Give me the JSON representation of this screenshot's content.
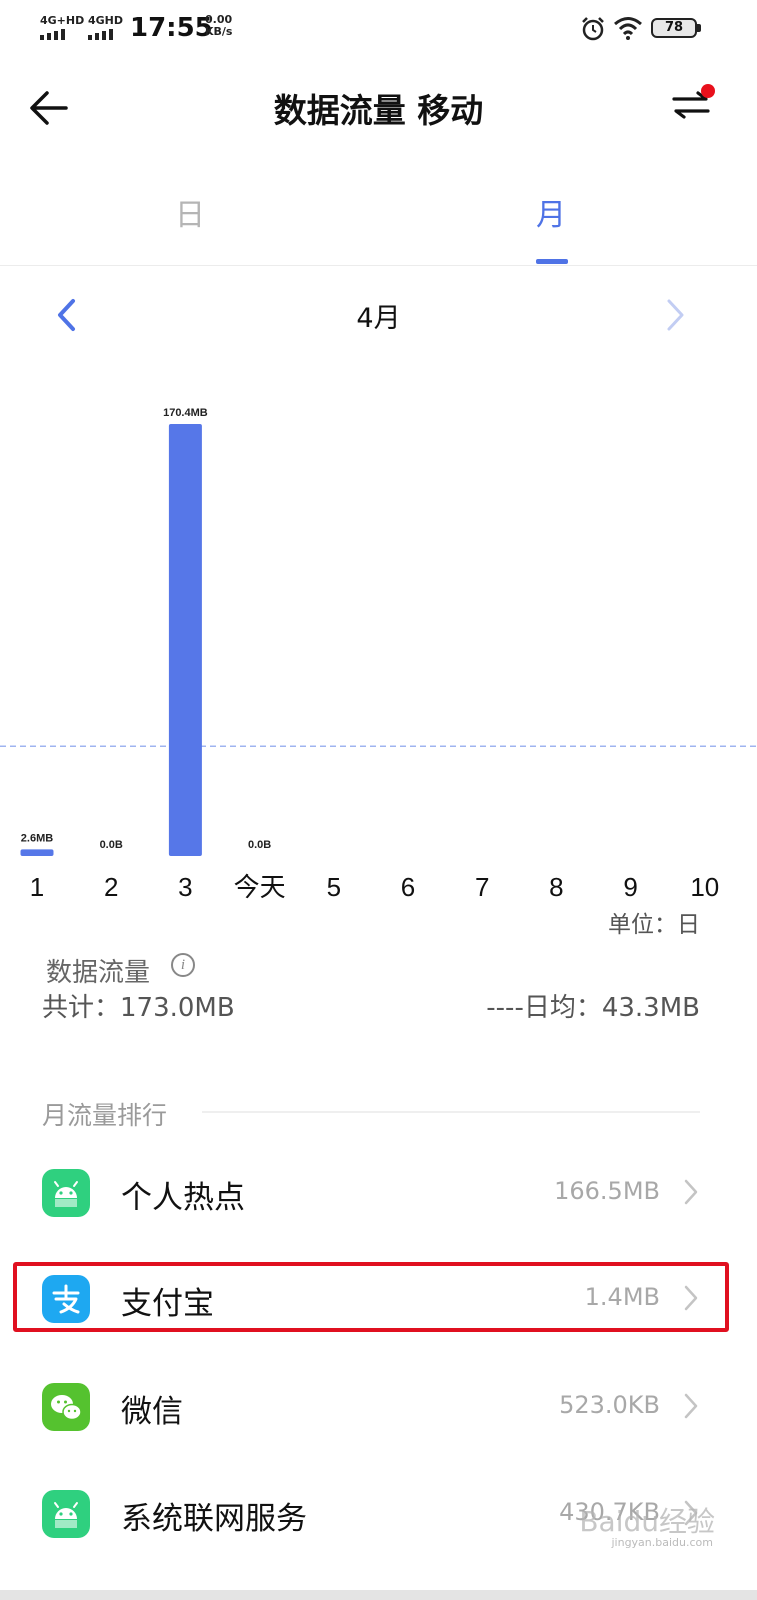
{
  "status_bar": {
    "sim1": "4G+HD",
    "sim2": "4GHD",
    "time": "17:55",
    "speed_value": "0.00",
    "speed_unit": "KB/s",
    "battery": "78"
  },
  "header": {
    "title": "数据流量 移动",
    "back_icon": "back-arrow-icon",
    "switch_icon": "swap-arrows-icon",
    "accent": "#4f73e6",
    "notify_dot_color": "#e8101c"
  },
  "tabs": [
    {
      "label": "日",
      "selected": false
    },
    {
      "label": "月",
      "selected": true
    }
  ],
  "month_nav": {
    "label": "4月",
    "prev_icon": "chevron-left-icon",
    "next_icon": "chevron-right-icon"
  },
  "chart_data": {
    "type": "bar",
    "categories": [
      "1",
      "2",
      "3",
      "今天",
      "5",
      "6",
      "7",
      "8",
      "9",
      "10"
    ],
    "values": [
      2.6,
      0.0,
      170.4,
      0.0,
      null,
      null,
      null,
      null,
      null,
      null
    ],
    "data_labels": [
      "2.6MB",
      "0.0B",
      "170.4MB",
      "0.0B"
    ],
    "ylim": [
      0,
      170.4
    ],
    "reference_line": 43.3,
    "bar_color": "#5677e8",
    "reference_line_color": "#9fb4f0"
  },
  "unit_label": "单位：日",
  "summary": {
    "title": "数据流量",
    "info_icon": "info-icon",
    "total": "共计：173.0MB",
    "daily_avg": "----日均：43.3MB"
  },
  "ranking": {
    "title": "月流量排行",
    "items": [
      {
        "name": "个人热点",
        "usage": "166.5MB",
        "icon": "android-icon"
      },
      {
        "name": "支付宝",
        "usage": "1.4MB",
        "icon": "alipay-icon"
      },
      {
        "name": "微信",
        "usage": "523.0KB",
        "icon": "wechat-icon"
      },
      {
        "name": "系统联网服务",
        "usage": "430.7KB",
        "icon": "android-icon"
      }
    ]
  },
  "highlight_color": "#e01020",
  "watermark": {
    "text": "Baidu经验",
    "sub": "jingyan.baidu.com"
  }
}
